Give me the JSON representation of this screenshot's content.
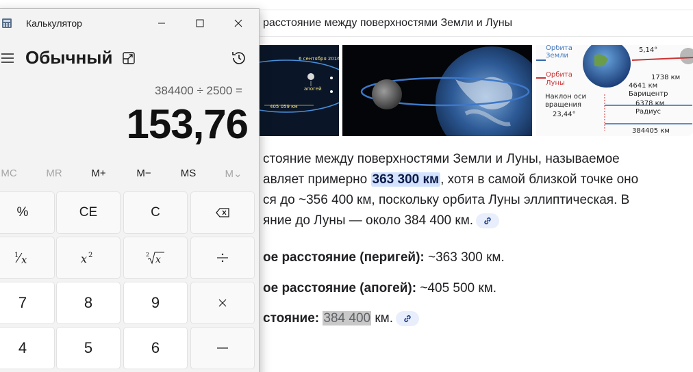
{
  "browser": {
    "query": "расстояние между поверхностями Земли и Луны",
    "images": [
      {
        "labels": {
          "date": "6 сентября 2016",
          "apogee": "апогей",
          "distance": "405 059 км"
        }
      },
      {
        "labels": {}
      },
      {
        "labels": {
          "earth_orbit": "Орбита Земли",
          "moon_orbit": "Орбита Луны",
          "axis_tilt": "Наклон оси вращения",
          "tilt_value": "23,44°",
          "angle": "5,14°",
          "moon_radius": "1738 км",
          "barycenter_dist": "4641 км",
          "barycenter": "Барицентр",
          "earth_radius": "6378 км",
          "radius": "Радиус",
          "total": "384405 км"
        }
      }
    ],
    "answer": {
      "line1": "стояние между поверхностями Земли и Луны, называемое",
      "line2_pre": "авляет примерно ",
      "line2_hl": "363 300 км",
      "line2_post": ", хотя в самой близкой точке оно",
      "line3": "ся до ~356 400 км, поскольку орбита Луны эллиптическая. В",
      "line4": "яние до Луны — около 384 400 км."
    },
    "bullets": [
      {
        "label": "ое расстояние (перигей):",
        "value": " ~363 300 км."
      },
      {
        "label": "ое расстояние (апогей):",
        "value": " ~405 500 км."
      },
      {
        "label": "стояние:",
        "value_hl": "384 400",
        "value_post": " км."
      }
    ]
  },
  "calculator": {
    "title": "Калькулятор",
    "mode": "Обычный",
    "expression": "384400 ÷ 2500 =",
    "result": "153,76",
    "memory": [
      "MC",
      "MR",
      "M+",
      "M−",
      "MS",
      "M⌄"
    ],
    "keys": {
      "percent": "%",
      "ce": "CE",
      "c": "C",
      "seven": "7",
      "eight": "8",
      "nine": "9",
      "four": "4",
      "five": "5",
      "six": "6"
    }
  }
}
